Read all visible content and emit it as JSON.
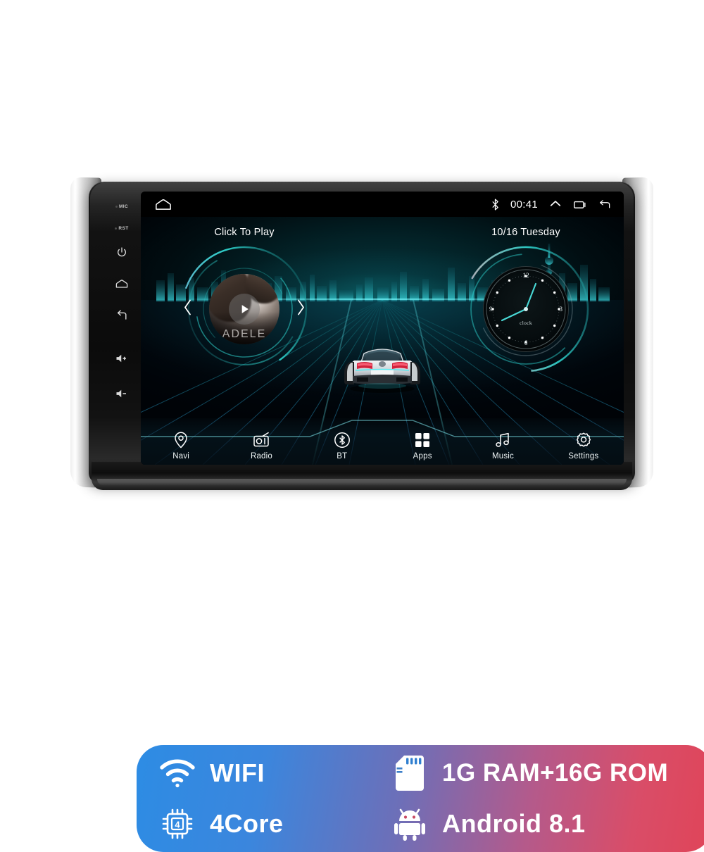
{
  "device": {
    "type": "android-car-stereo-head-unit",
    "hardware_keys": [
      {
        "name": "mic",
        "label": "MIC",
        "icon": "mic-indicator-icon"
      },
      {
        "name": "reset",
        "label": "RST",
        "icon": "reset-indicator-icon"
      },
      {
        "name": "power",
        "label": "",
        "icon": "power-icon"
      },
      {
        "name": "home",
        "label": "",
        "icon": "home-icon"
      },
      {
        "name": "back",
        "label": "",
        "icon": "back-arrow-icon"
      },
      {
        "name": "volume-up",
        "label": "",
        "icon": "volume-up-icon"
      },
      {
        "name": "volume-down",
        "label": "",
        "icon": "volume-down-icon"
      }
    ]
  },
  "statusbar": {
    "home_icon": "home-icon",
    "bluetooth_icon": "bluetooth-icon",
    "time": "00:41",
    "expand_icon": "chevron-up-icon",
    "recents_icon": "recents-icon",
    "back_icon": "back-arrow-icon"
  },
  "media_widget": {
    "title": "Click To Play",
    "album_artist": "ADELE",
    "play_icon": "play-icon",
    "prev_icon": "chevron-left-icon",
    "next_icon": "chevron-right-icon",
    "ring_color": "#2fd6d0",
    "ring_accent": "#a86ce0"
  },
  "clock_widget": {
    "date": "10/16  Tuesday",
    "face_label": "clock",
    "numerals": {
      "twelve": "12",
      "three": "3",
      "six": "6",
      "nine": "9"
    },
    "hand_color": "#49d9d6",
    "hour_angle_deg": -105,
    "minute_angle_deg": 18
  },
  "wallpaper": {
    "theme": "night-city-skyline-with-car-on-grid-road",
    "grid_color": "#1f7f8c",
    "glow_color": "#1abec3"
  },
  "dock": {
    "items": [
      {
        "label": "Navi",
        "icon": "location-pin-icon"
      },
      {
        "label": "Radio",
        "icon": "radio-icon"
      },
      {
        "label": "BT",
        "icon": "bluetooth-circle-icon"
      },
      {
        "label": "Apps",
        "icon": "apps-grid-icon"
      },
      {
        "label": "Music",
        "icon": "music-note-icon"
      },
      {
        "label": "Settings",
        "icon": "gear-icon"
      }
    ]
  },
  "spec_banner": {
    "gradient_start": "#2d8ce4",
    "gradient_end": "#e04458",
    "specs": [
      {
        "label": "WIFI",
        "icon": "wifi-icon"
      },
      {
        "label": "1G RAM+16G ROM",
        "icon": "sd-card-icon"
      },
      {
        "label": "4Core",
        "icon": "cpu-chip-icon",
        "chip_digit": "4"
      },
      {
        "label": "Android 8.1",
        "icon": "android-robot-icon"
      }
    ]
  }
}
